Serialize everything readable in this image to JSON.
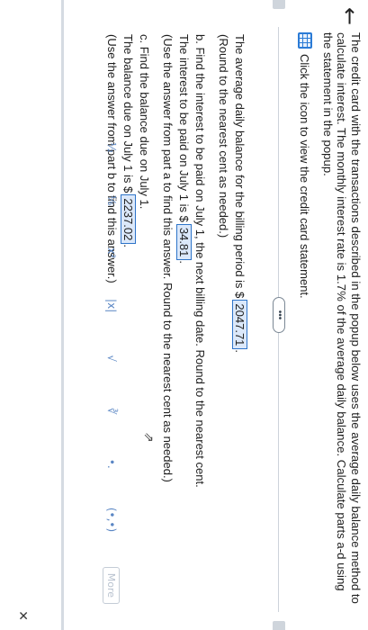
{
  "intro": {
    "text": "The credit card with the transactions described in the popup below uses the average daily balance method to calculate interest. The monthly interest rate is 1.7% of the average daily balance. Calculate parts a-d using the statement in the popup.",
    "statement_link": "Click the icon to view the credit card statement."
  },
  "more_pill": "•••",
  "answers": {
    "a_prefix": "The average daily balance for the billing period is $",
    "a_value": "2047.71",
    "a_suffix": ".",
    "a_hint": "(Round to the nearest cent as needed.)",
    "b_question": "b. Find the interest to be paid on July 1, the next billing date. Round to the nearest cent.",
    "b_prefix": "The interest to be paid on July 1 is $",
    "b_value": "34.81",
    "b_suffix": ".",
    "b_hint": "(Use the answer from part a to find this answer. Round to the nearest cent as needed.)",
    "c_question": "c. Find the balance due on July 1.",
    "c_prefix": "The balance due on July 1 is $",
    "c_value": "2237.02",
    "c_suffix": ".",
    "c_hint": "(Use the answer from part b to find this answer.)"
  },
  "toolbar": {
    "fraction": "½",
    "mixed": "⅙",
    "exponent": "x²",
    "abs": "|x|",
    "sqrt": "√",
    "nroot": "∛",
    "decimal": "•.",
    "paren": "(•,•)",
    "more": "More"
  },
  "close": "✕",
  "back": "←"
}
